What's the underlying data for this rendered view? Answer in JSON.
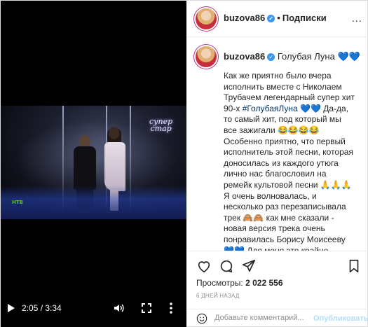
{
  "video": {
    "time": "2:05 / 3:34",
    "show_logo_line1": "супер",
    "show_logo_line2": "стар",
    "channel_logo": "НТВ"
  },
  "header": {
    "username": "buzova86",
    "follow_label": "Подписки",
    "separator": "•",
    "more": "..."
  },
  "caption": {
    "username": "buzova86",
    "title": "Голубая Луна 💙💙",
    "text_part1": "Как же приятно было вчера исполнить вместе с Николаем Трубачем легендарный супер хит 90-х ",
    "hashtag": "#ГолубаяЛуна",
    "text_part2": " 💙💙 Да-да, то самый хит, под который мы все зажигали 😂😂😂😂Особенно приятно, что первый исполнитель этой песни, которая доносилась из каждого утюга лично нас благословил на ремейк культовой песни 🙏🙏🙏 Я очень волновалась, и несколько раз перезаписывала трек 🙈🙈 как мне сказали - новая версия трека очень понравилась Борису Моисееву 💙💙 Для меня это крайне приятно 😊\nКстати, Николай Трубач, который является автором песни, сказал, что"
  },
  "actions": {
    "icons": [
      "heart-icon",
      "comment-icon",
      "share-icon",
      "bookmark-icon"
    ],
    "views_label": "Просмотры: ",
    "views_count": "2 022 556",
    "posted_ago": "6 ДНЕЙ НАЗАД"
  },
  "comment": {
    "placeholder": "Добавьте комментарий...",
    "publish_label": "Опубликовать"
  },
  "colors": {
    "link": "#00376b",
    "verified": "#3897f0",
    "publish_disabled": "#b2dffc"
  }
}
